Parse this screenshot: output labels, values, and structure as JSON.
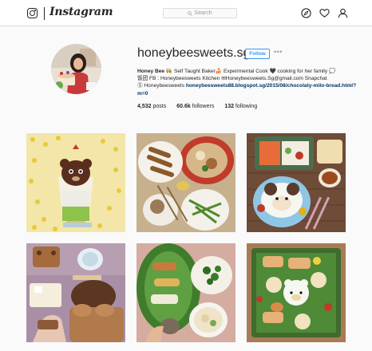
{
  "header": {
    "brand": "Instagram",
    "search_placeholder": "Search",
    "icons": [
      "instagram-logo-icon",
      "compass-icon",
      "heart-icon",
      "profile-icon"
    ]
  },
  "profile": {
    "username": "honeybeesweets.sg",
    "follow_label": "Follow",
    "more_label": "•••",
    "bio_name": "Honey Bee",
    "bio_line1": " 👩‍🍳 Self Taught Baker🍰 Experimental Cook 🖤 cooking for her family 💭",
    "bio_line2": "饭团 FB : Honeybeesweets Kitchen ✉Honeybeesweets.Sg@gmail.com Snapchat",
    "bio_line3": "Ⓢ Honeybeesweets",
    "bio_link": "honeybeesweets88.blogspot.sg/2015/08/chocolaty-milo-bread.html?m=0",
    "posts_count": "4,532",
    "posts_label": "posts",
    "followers_count": "60.6k",
    "followers_label": "followers",
    "following_count": "132",
    "following_label": "following"
  },
  "posts": [
    {
      "subject": "bear parfait on yellow polka dots"
    },
    {
      "subject": "red pot with chicken stew and vegetables"
    },
    {
      "subject": "salmon bento and character rice bowl"
    },
    {
      "subject": "bear bread loaf and teddy toasts"
    },
    {
      "subject": "banana leaf meal with soup"
    },
    {
      "subject": "rilakkuma bento box"
    }
  ],
  "colors": {
    "accent": "#3897f0",
    "link": "#003569",
    "border": "#dbdbdb",
    "background": "#fafafa"
  }
}
